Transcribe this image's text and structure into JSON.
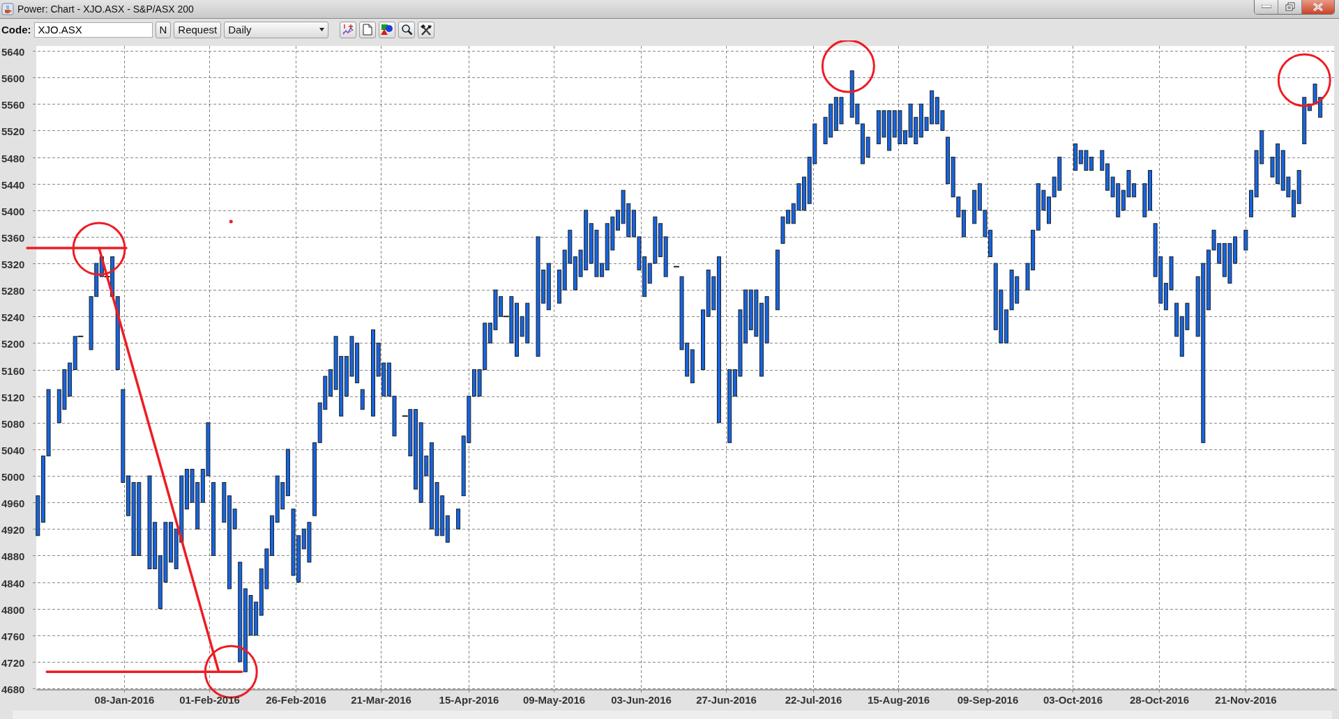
{
  "window": {
    "title": "Power: Chart - XJO.ASX - S&P/ASX 200"
  },
  "toolbar": {
    "code_label": "Code:",
    "code_value": "XJO.ASX",
    "buttons": [
      "N",
      "Request"
    ],
    "period": "Daily"
  },
  "chart": {
    "y_axis_labels": [
      "5640",
      "5600",
      "5560",
      "5520",
      "5480",
      "5440",
      "5400",
      "5360",
      "5320",
      "5280",
      "5240",
      "5200",
      "5160",
      "5120",
      "5080",
      "5040",
      "5000",
      "4960",
      "4920",
      "4880",
      "4840",
      "4800",
      "4760",
      "4720",
      "4680"
    ],
    "x_axis_labels": [
      "08-Jan-2016",
      "01-Feb-2016",
      "26-Feb-2016",
      "21-Mar-2016",
      "15-Apr-2016",
      "09-May-2016",
      "03-Jun-2016",
      "27-Jun-2016",
      "22-Jul-2016",
      "15-Aug-2016",
      "09-Sep-2016",
      "03-Oct-2016",
      "28-Oct-2016",
      "21-Nov-2016"
    ]
  }
}
